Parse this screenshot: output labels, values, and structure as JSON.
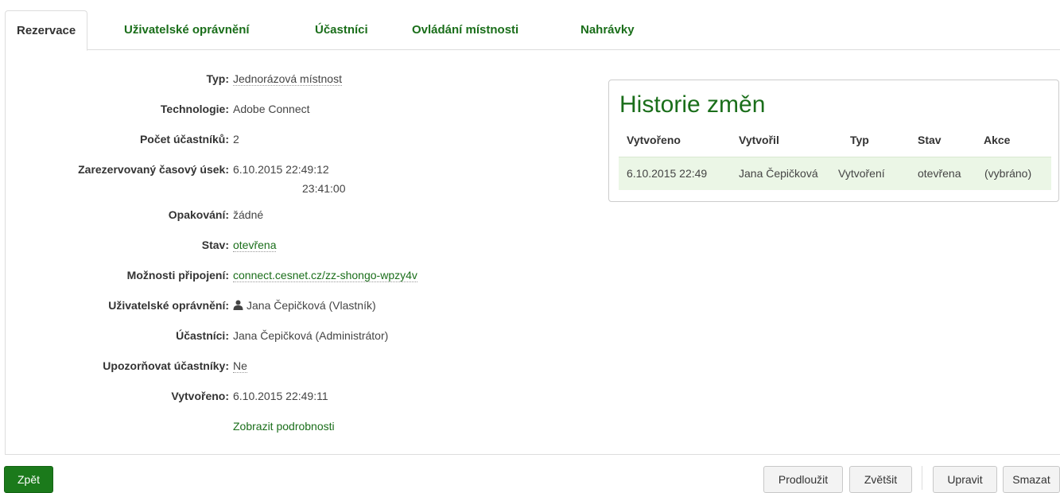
{
  "tabs": [
    "Rezervace",
    "Uživatelské oprávnění",
    "Účastníci",
    "Ovládání místnosti",
    "Nahrávky"
  ],
  "details": {
    "type_label": "Typ:",
    "type_value": "Jednorázová místnost",
    "technology_label": "Technologie:",
    "technology_value": "Adobe Connect",
    "participants_count_label": "Počet účastníků:",
    "participants_count_value": "2",
    "slot_label": "Zarezervovaný časový úsek:",
    "slot_start": "6.10.2015 22:49:12",
    "slot_end": "23:41:00",
    "recurrence_label": "Opakování:",
    "recurrence_value": "žádné",
    "state_label": "Stav:",
    "state_value": "otevřena",
    "connection_label": "Možnosti připojení:",
    "connection_value": "connect.cesnet.cz/zz-shongo-wpzy4v",
    "permissions_label": "Uživatelské oprávnění:",
    "permissions_value": "Jana Čepičková (Vlastník)",
    "participants_label": "Účastníci:",
    "participants_value": "Jana Čepičková (Administrátor)",
    "notify_label": "Upozorňovat účastníky:",
    "notify_value": "Ne",
    "created_label": "Vytvořeno:",
    "created_value": "6.10.2015 22:49:11",
    "show_details": "Zobrazit podrobnosti"
  },
  "history": {
    "title": "Historie změn",
    "columns": [
      "Vytvořeno",
      "Vytvořil",
      "Typ",
      "Stav",
      "Akce"
    ],
    "rows": [
      [
        "6.10.2015 22:49",
        "Jana Čepičková",
        "Vytvoření",
        "otevřena",
        "(vybráno)"
      ]
    ]
  },
  "buttons": {
    "back": "Zpět",
    "extend": "Prodloužit",
    "enlarge": "Zvětšit",
    "edit": "Upravit",
    "delete": "Smazat"
  },
  "colors": {
    "accent": "#1a6e1a",
    "button_green": "#1b7a1b",
    "row_highlight": "#ebf6e6"
  },
  "icons": {
    "owner": "user-icon"
  }
}
